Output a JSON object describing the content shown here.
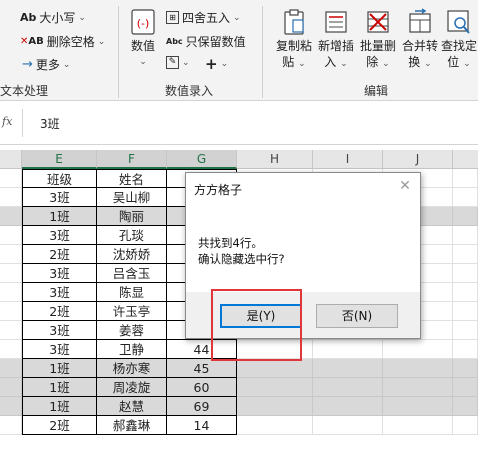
{
  "ribbon": {
    "text_group": {
      "case_label": "大小写",
      "remove_spaces_label": "删除空格",
      "more_label": "更多",
      "group_label": "文本处理"
    },
    "number_group": {
      "number_label": "数值",
      "round_label": "四舍五入",
      "keep_value_label": "只保留数值",
      "group_label": "数值录入"
    },
    "edit_group": {
      "buttons": [
        {
          "line1": "复制粘",
          "line2": "贴"
        },
        {
          "line1": "新增插",
          "line2": "入"
        },
        {
          "line1": "批量删",
          "line2": "除"
        },
        {
          "line1": "合并转",
          "line2": "换"
        },
        {
          "line1": "查找定",
          "line2": "位"
        }
      ],
      "group_label": "编辑"
    }
  },
  "formula_bar": {
    "fx": "fx",
    "value": "3班"
  },
  "columns": [
    "E",
    "F",
    "G",
    "H",
    "I",
    "J"
  ],
  "table": {
    "header": [
      "班级",
      "姓名",
      ""
    ],
    "rows": [
      {
        "c": "3班",
        "n": "吴山柳",
        "s": ""
      },
      {
        "c": "1班",
        "n": "陶丽",
        "s": ""
      },
      {
        "c": "3班",
        "n": "孔琰",
        "s": ""
      },
      {
        "c": "2班",
        "n": "沈娇娇",
        "s": ""
      },
      {
        "c": "3班",
        "n": "吕含玉",
        "s": ""
      },
      {
        "c": "3班",
        "n": "陈显",
        "s": ""
      },
      {
        "c": "2班",
        "n": "许玉亭",
        "s": ""
      },
      {
        "c": "3班",
        "n": "姜蓉",
        "s": ""
      },
      {
        "c": "3班",
        "n": "卫静",
        "s": "44"
      },
      {
        "c": "1班",
        "n": "杨亦寒",
        "s": "45"
      },
      {
        "c": "1班",
        "n": "周凌旋",
        "s": "60"
      },
      {
        "c": "1班",
        "n": "赵慧",
        "s": "69"
      },
      {
        "c": "2班",
        "n": "郝鑫琳",
        "s": "14"
      }
    ]
  },
  "dialog": {
    "title": "方方格子",
    "line1": "共找到4行。",
    "line2": "确认隐藏选中行?",
    "yes_label": "是(Y)",
    "no_label": "否(N)"
  },
  "colors": {
    "highlight": "#d9d9d9",
    "accent": "#217346",
    "annotation": "#e0363a"
  }
}
